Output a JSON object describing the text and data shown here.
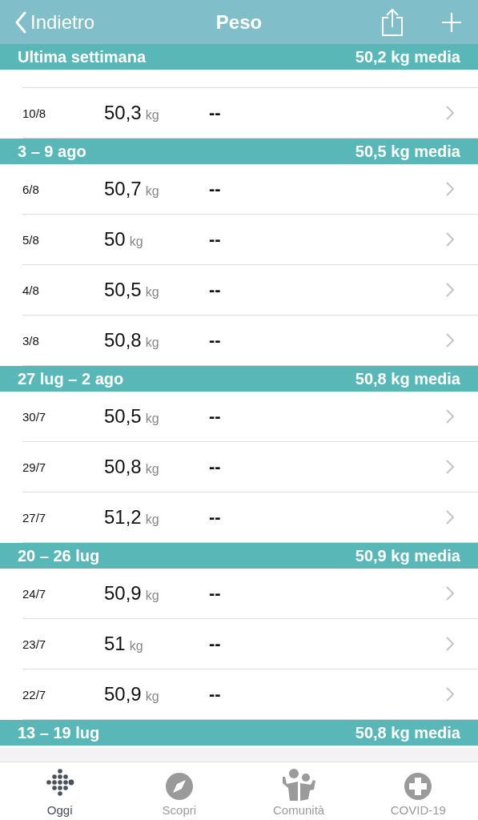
{
  "nav": {
    "back": "Indietro",
    "title": "Peso"
  },
  "sections": [
    {
      "title": "Ultima settimana",
      "average": "50,2 kg media",
      "partial_top": true,
      "rows": [
        {
          "date": "10/8",
          "value": "50,3",
          "unit": "kg",
          "note": "--"
        }
      ]
    },
    {
      "title": "3 – 9 ago",
      "average": "50,5 kg media",
      "rows": [
        {
          "date": "6/8",
          "value": "50,7",
          "unit": "kg",
          "note": "--"
        },
        {
          "date": "5/8",
          "value": "50",
          "unit": "kg",
          "note": "--"
        },
        {
          "date": "4/8",
          "value": "50,5",
          "unit": "kg",
          "note": "--"
        },
        {
          "date": "3/8",
          "value": "50,8",
          "unit": "kg",
          "note": "--"
        }
      ]
    },
    {
      "title": "27 lug – 2 ago",
      "average": "50,8 kg media",
      "rows": [
        {
          "date": "30/7",
          "value": "50,5",
          "unit": "kg",
          "note": "--"
        },
        {
          "date": "29/7",
          "value": "50,8",
          "unit": "kg",
          "note": "--"
        },
        {
          "date": "27/7",
          "value": "51,2",
          "unit": "kg",
          "note": "--"
        }
      ]
    },
    {
      "title": "20 – 26 lug",
      "average": "50,9 kg media",
      "rows": [
        {
          "date": "24/7",
          "value": "50,9",
          "unit": "kg",
          "note": "--"
        },
        {
          "date": "23/7",
          "value": "51",
          "unit": "kg",
          "note": "--"
        },
        {
          "date": "22/7",
          "value": "50,9",
          "unit": "kg",
          "note": "--"
        }
      ]
    },
    {
      "title": "13 – 19 lug",
      "average": "50,8 kg media"
    }
  ],
  "tabs": [
    {
      "label": "Oggi",
      "kind": "today",
      "selected": true
    },
    {
      "label": "Scopri",
      "kind": "discover",
      "selected": false
    },
    {
      "label": "Comunità",
      "kind": "community",
      "selected": false
    },
    {
      "label": "COVID-19",
      "kind": "covid",
      "selected": false
    }
  ]
}
